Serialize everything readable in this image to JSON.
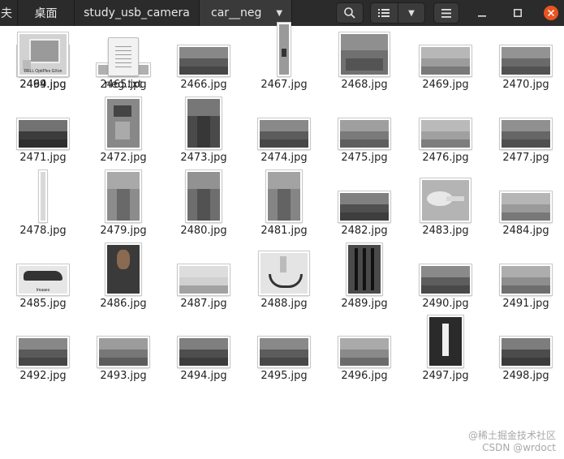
{
  "header": {
    "crumbs": [
      "夫",
      "桌面",
      "study_usb_camera",
      "car__neg"
    ],
    "search_icon": "search-icon",
    "list_view_icon": "list-view-icon",
    "view_options_icon": "chevron-down-icon",
    "menu_icon": "hamburger-menu-icon",
    "minimize_icon": "minimize-icon",
    "maximize_icon": "maximize-icon",
    "close_icon": "close-icon",
    "colors": {
      "bar": "#2b2b2b",
      "close": "#e95420"
    }
  },
  "files": [
    {
      "name": "2464.jpg",
      "shape": "landscape",
      "tone": "#8a8a8a"
    },
    {
      "name": "2465.jpg",
      "shape": "strip",
      "tone": "#b0b0b0"
    },
    {
      "name": "2466.jpg",
      "shape": "landscape",
      "tone": "#5a5a5a"
    },
    {
      "name": "2467.jpg",
      "shape": "tall",
      "tone": "#9a9a9a"
    },
    {
      "name": "2468.jpg",
      "shape": "square",
      "tone": "#707070"
    },
    {
      "name": "2469.jpg",
      "shape": "landscape",
      "tone": "#9c9c9c"
    },
    {
      "name": "2470.jpg",
      "shape": "landscape",
      "tone": "#6a6a6a"
    },
    {
      "name": "2471.jpg",
      "shape": "landscape",
      "tone": "#3c3c3c"
    },
    {
      "name": "2472.jpg",
      "shape": "portrait",
      "tone": "#888888"
    },
    {
      "name": "2473.jpg",
      "shape": "portrait",
      "tone": "#4a4a4a"
    },
    {
      "name": "2474.jpg",
      "shape": "landscape",
      "tone": "#5c5c5c"
    },
    {
      "name": "2475.jpg",
      "shape": "landscape",
      "tone": "#7a7a7a"
    },
    {
      "name": "2476.jpg",
      "shape": "landscape",
      "tone": "#a0a0a0"
    },
    {
      "name": "2477.jpg",
      "shape": "landscape",
      "tone": "#666666"
    },
    {
      "name": "2478.jpg",
      "shape": "thin",
      "tone": "#d8d8d8"
    },
    {
      "name": "2479.jpg",
      "shape": "portrait",
      "tone": "#8c8c8c"
    },
    {
      "name": "2480.jpg",
      "shape": "portrait",
      "tone": "#6e6e6e"
    },
    {
      "name": "2481.jpg",
      "shape": "portrait",
      "tone": "#858585"
    },
    {
      "name": "2482.jpg",
      "shape": "landscape",
      "tone": "#505050"
    },
    {
      "name": "2483.jpg",
      "shape": "square",
      "tone": "#b4b4b4"
    },
    {
      "name": "2484.jpg",
      "shape": "landscape",
      "tone": "#9a9a9a"
    },
    {
      "name": "2485.jpg",
      "shape": "landscape",
      "tone": "#e6e6e6"
    },
    {
      "name": "2486.jpg",
      "shape": "portrait",
      "tone": "#3a3a3a"
    },
    {
      "name": "2487.jpg",
      "shape": "landscape",
      "tone": "#d0d0d0"
    },
    {
      "name": "2488.jpg",
      "shape": "square",
      "tone": "#e4e4e4"
    },
    {
      "name": "2489.jpg",
      "shape": "portrait",
      "tone": "#4a4a4a"
    },
    {
      "name": "2490.jpg",
      "shape": "landscape",
      "tone": "#5e5e5e"
    },
    {
      "name": "2491.jpg",
      "shape": "landscape",
      "tone": "#8e8e8e"
    },
    {
      "name": "2492.jpg",
      "shape": "landscape",
      "tone": "#5a5a5a"
    },
    {
      "name": "2493.jpg",
      "shape": "landscape",
      "tone": "#777777"
    },
    {
      "name": "2494.jpg",
      "shape": "landscape",
      "tone": "#4e4e4e"
    },
    {
      "name": "2495.jpg",
      "shape": "landscape",
      "tone": "#5c5c5c"
    },
    {
      "name": "2496.jpg",
      "shape": "landscape",
      "tone": "#8a8a8a"
    },
    {
      "name": "2497.jpg",
      "shape": "portrait",
      "tone": "#2a2a2a"
    },
    {
      "name": "2498.jpg",
      "shape": "landscape",
      "tone": "#4c4c4c"
    },
    {
      "name": "2499.jpg",
      "shape": "square",
      "tone": "#d2d2d2"
    },
    {
      "name": "neg.txt",
      "shape": "doc",
      "tone": "#f2f2f2"
    }
  ],
  "thumb_texts": {
    "2485.jpg": "Imaaes",
    "2499.jpg": "DELL OptiPlex GXon"
  },
  "watermark": {
    "line1": "@稀土掘金技术社区",
    "line2": "CSDN @wrdoct"
  }
}
